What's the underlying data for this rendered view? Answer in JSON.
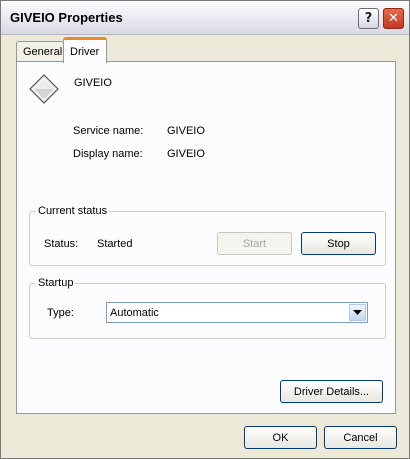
{
  "window": {
    "title": "GIVEIO Properties",
    "help_glyph": "?",
    "close_glyph": "✕"
  },
  "tabs": [
    {
      "label": "General",
      "selected": false
    },
    {
      "label": "Driver",
      "selected": true
    }
  ],
  "driver": {
    "name": "GIVEIO",
    "icon": "driver-diamond-icon",
    "service_name_label": "Service name:",
    "service_name_value": "GIVEIO",
    "display_name_label": "Display name:",
    "display_name_value": "GIVEIO"
  },
  "current_status": {
    "group_label": "Current status",
    "status_label": "Status:",
    "status_value": "Started",
    "start_label": "Start",
    "start_enabled": false,
    "stop_label": "Stop"
  },
  "startup": {
    "group_label": "Startup",
    "type_label": "Type:",
    "type_value": "Automatic"
  },
  "buttons": {
    "details": "Driver Details...",
    "ok": "OK",
    "cancel": "Cancel"
  },
  "colors": {
    "dialog_background": "#ece9d8",
    "panel_background": "#fcfcfe",
    "active_tab_accent": "#e68b2c",
    "button_border": "#003c74"
  }
}
